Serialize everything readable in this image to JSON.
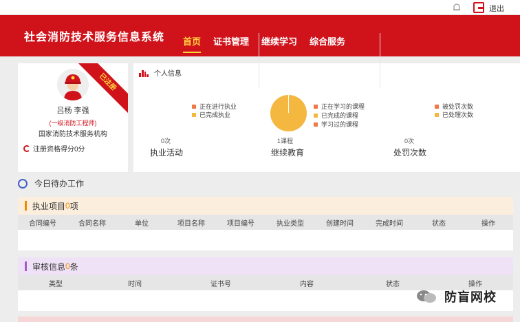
{
  "topbar": {
    "logout_label": "退出"
  },
  "header": {
    "title": "社会消防技术服务信息系统",
    "tabs": [
      {
        "label": "首页",
        "active": true
      },
      {
        "label": "证书管理",
        "active": false
      },
      {
        "label": "继续学习",
        "active": false
      },
      {
        "label": "综合服务",
        "active": false
      }
    ]
  },
  "profile": {
    "ribbon": "已注册",
    "name": "吕杨 李强",
    "role": "(一级消防工程师)",
    "desc": "国家消防技术服务机构",
    "score": "注册资格得分0分"
  },
  "stats": {
    "header": "个人信息",
    "blocks": [
      {
        "legend": [
          {
            "label": "正在进行执业",
            "color": "#f0794a"
          },
          {
            "label": "已完成执业",
            "color": "#f4b740"
          }
        ],
        "value": "0次",
        "label": "执业活动"
      },
      {
        "legend": [
          {
            "label": "正在学习的课程",
            "color": "#f0794a"
          },
          {
            "label": "已完成的课程",
            "color": "#f4b740"
          },
          {
            "label": "学习过的课程",
            "color": "#f0794a"
          }
        ],
        "value": "1课程",
        "label": "继续教育"
      },
      {
        "legend": [
          {
            "label": "被处罚次数",
            "color": "#f0794a"
          },
          {
            "label": "已处理次数",
            "color": "#f4b740"
          }
        ],
        "value": "0次",
        "label": "处罚次数"
      }
    ]
  },
  "tasks": {
    "title": "今日待办工作"
  },
  "practice": {
    "title": "执业项目",
    "count": "0",
    "unit": "项",
    "columns": [
      "合同编号",
      "合同名称",
      "单位",
      "项目名称",
      "项目编号",
      "执业类型",
      "创建时间",
      "完成时间",
      "状态",
      "操作"
    ]
  },
  "review": {
    "title": "审核信息",
    "count": "0",
    "unit": "条",
    "columns": [
      "类型",
      "时间",
      "证书号",
      "内容",
      "状态",
      "操作"
    ]
  },
  "watermark": {
    "text": "防盲网校"
  }
}
